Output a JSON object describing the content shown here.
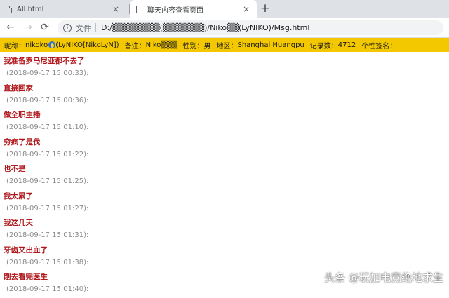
{
  "tabs": [
    {
      "title": "All.html",
      "close": "×"
    },
    {
      "title": "聊天内容查看页面",
      "close": "×"
    }
  ],
  "newtab": "+",
  "nav": {
    "back": "←",
    "forward": "→",
    "reload": "⟳"
  },
  "address": {
    "info": "i",
    "label": "文件",
    "url": "D:/▒▒▒▒▒▒▒▒(▒▒▒▒▒▒▒)/Niko▒▒(LyNIKO)/Msg.html"
  },
  "profile": {
    "nickname_label": "昵称：",
    "nickname_pre": "nikoko",
    "nickname_post": "(LyNIKO[NikoLyN])",
    "remark_label": "备注：",
    "remark": "Niko▒▒▒",
    "gender_label": "性别：",
    "gender": "男",
    "region_label": "地区：",
    "region": "Shanghai Huangpu",
    "count_label": "记录数：",
    "count": "4712",
    "signature_label": "个性签名："
  },
  "messages": [
    {
      "text": "我准备罗马尼亚都不去了",
      "time": "(2018-09-17 15:00:33):"
    },
    {
      "text": "直接回家",
      "time": "(2018-09-17 15:00:36):"
    },
    {
      "text": "做全职主播",
      "time": "(2018-09-17 15:01:10):"
    },
    {
      "text": "穷疯了是伐",
      "time": "(2018-09-17 15:01:22):"
    },
    {
      "text": "也不是",
      "time": "(2018-09-17 15:01:25):"
    },
    {
      "text": "我太累了",
      "time": "(2018-09-17 15:01:27):"
    },
    {
      "text": "我这几天",
      "time": "(2018-09-17 15:01:31):"
    },
    {
      "text": "牙齿又出血了",
      "time": "(2018-09-17 15:01:38):"
    },
    {
      "text": "刚去看完医生",
      "time": "(2018-09-17 15:01:40):"
    }
  ],
  "watermark": "头条 @玩加电竞绝地求生"
}
